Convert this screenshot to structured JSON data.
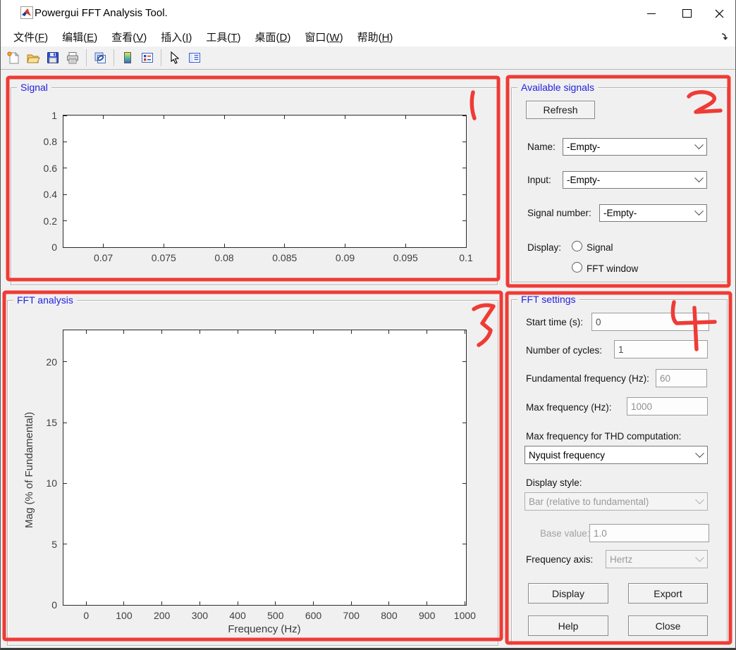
{
  "window": {
    "title": "Powergui FFT Analysis Tool."
  },
  "menubar": {
    "items": [
      {
        "pre": "文件(",
        "key": "F",
        "post": ")"
      },
      {
        "pre": "编辑(",
        "key": "E",
        "post": ")"
      },
      {
        "pre": "查看(",
        "key": "V",
        "post": ")"
      },
      {
        "pre": "插入(",
        "key": "I",
        "post": ")"
      },
      {
        "pre": "工具(",
        "key": "T",
        "post": ")"
      },
      {
        "pre": "桌面(",
        "key": "D",
        "post": ")"
      },
      {
        "pre": "窗口(",
        "key": "W",
        "post": ")"
      },
      {
        "pre": "帮助(",
        "key": "H",
        "post": ")"
      }
    ]
  },
  "toolbar": {
    "icons": [
      "new-file",
      "open-file",
      "save",
      "print",
      "link-plot",
      "insert-colorbar",
      "insert-legend",
      "edit-plot",
      "property-editor"
    ]
  },
  "signal_panel": {
    "title": "Signal"
  },
  "available_signals": {
    "title": "Available signals",
    "refresh_label": "Refresh",
    "name_label": "Name:",
    "name_value": "-Empty-",
    "input_label": "Input:",
    "input_value": "-Empty-",
    "signal_number_label": "Signal number:",
    "signal_number_value": "-Empty-",
    "display_label": "Display:",
    "radio_signal": "Signal",
    "radio_fft_window": "FFT window"
  },
  "fft_analysis_panel": {
    "title": "FFT analysis"
  },
  "fft_settings": {
    "title": "FFT settings",
    "start_time_label": "Start time (s):",
    "start_time_value": "0",
    "cycles_label": "Number of cycles:",
    "cycles_value": "1",
    "fundamental_label": "Fundamental frequency (Hz):",
    "fundamental_value": "60",
    "max_freq_label": "Max frequency (Hz):",
    "max_freq_value": "1000",
    "thd_label": "Max frequency for THD computation:",
    "thd_value": "Nyquist frequency",
    "display_style_label": "Display style:",
    "display_style_value": "Bar (relative to fundamental)",
    "base_value_label": "Base value:",
    "base_value_value": "1.0",
    "freq_axis_label": "Frequency axis:",
    "freq_axis_value": "Hertz",
    "display_button": "Display",
    "export_button": "Export",
    "help_button": "Help",
    "close_button": "Close"
  },
  "annotations": {
    "color": "#ef3b36",
    "labels": [
      "1",
      "2",
      "3",
      "4"
    ]
  },
  "chart_data": [
    {
      "type": "line",
      "title": "Signal",
      "xlabel": "",
      "ylabel": "",
      "x_ticks": [
        0.07,
        0.075,
        0.08,
        0.085,
        0.09,
        0.095,
        0.1
      ],
      "y_ticks": [
        0,
        0.2,
        0.4,
        0.6,
        0.8,
        1
      ],
      "xlim": [
        0.0667,
        0.1
      ],
      "ylim": [
        0,
        1
      ],
      "grid": false,
      "series": [],
      "note": "empty axes - no signal loaded"
    },
    {
      "type": "bar",
      "title": "FFT analysis",
      "xlabel": "Frequency (Hz)",
      "ylabel": "Mag (% of Fundamental)",
      "x_ticks": [
        0,
        100,
        200,
        300,
        400,
        500,
        600,
        700,
        800,
        900,
        1000
      ],
      "y_ticks": [
        0,
        5,
        10,
        15,
        20
      ],
      "xlim": [
        -60,
        1003
      ],
      "ylim": [
        0,
        22.6
      ],
      "grid": false,
      "series": [],
      "note": "empty axes - no FFT computed"
    }
  ]
}
